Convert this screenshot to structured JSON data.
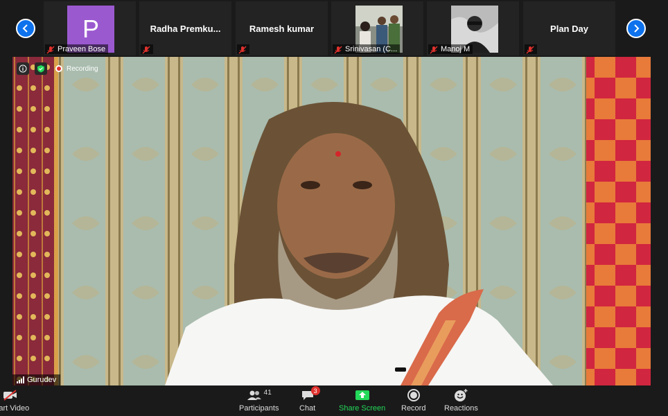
{
  "participants": [
    {
      "name": "Praveen Bose",
      "avatar_letter": "P",
      "muted": true
    },
    {
      "name": "Radha  Premku...",
      "muted": true
    },
    {
      "name": "Ramesh kumar",
      "muted": true
    },
    {
      "name": "Srinivasan (C...",
      "muted": true
    },
    {
      "name": "Manoj M",
      "muted": true
    },
    {
      "name": "Plan Day",
      "muted": true
    }
  ],
  "main_video": {
    "recording_label": "Recording",
    "speaker_name": "Gurudev"
  },
  "toolbar": {
    "start_video": "Start Video",
    "participants": "Participants",
    "participants_count": "41",
    "chat": "Chat",
    "chat_badge": "3",
    "share_screen": "Share Screen",
    "record": "Record",
    "reactions": "Reactions"
  },
  "colors": {
    "accent_blue": "#0e72ed",
    "share_green": "#23d959",
    "mute_red": "#e0312d",
    "avatar_purple": "#9b59d0"
  }
}
